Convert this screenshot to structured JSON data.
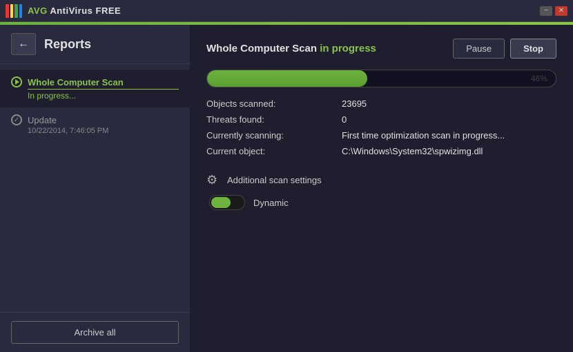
{
  "titlebar": {
    "logo_r": "red-block",
    "logo_y": "yellow-block",
    "logo_g": "green-block",
    "logo_b": "blue-block",
    "brand": "AVG",
    "product": " AntiVirus FREE",
    "minimize_label": "−",
    "close_label": "✕"
  },
  "sidebar": {
    "title": "Reports",
    "back_label": "←",
    "items": [
      {
        "name": "Whole Computer Scan",
        "status": "In progress...",
        "active": true,
        "icon_type": "play"
      },
      {
        "name": "Update",
        "date": "10/22/2014, 7:46:05 PM",
        "active": false,
        "icon_type": "check"
      }
    ],
    "archive_label": "Archive all"
  },
  "content": {
    "scan_title_part1": "Whole Computer Scan ",
    "scan_title_part2": "in progress",
    "pause_label": "Pause",
    "stop_label": "Stop",
    "progress_percent": 46,
    "progress_label": "46%",
    "stats": {
      "objects_scanned_label": "Objects scanned:",
      "objects_scanned_value": "23695",
      "threats_found_label": "Threats found:",
      "threats_found_value": "0",
      "currently_scanning_label": "Currently scanning:",
      "currently_scanning_value": "First time optimization scan in progress...",
      "current_object_label": "Current object:",
      "current_object_value": "C:\\Windows\\System32\\spwizimg.dll"
    },
    "additional_settings_label": "Additional scan settings",
    "dynamic_label": "Dynamic"
  }
}
